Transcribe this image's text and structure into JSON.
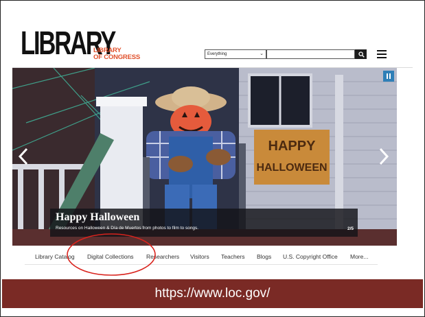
{
  "header": {
    "logo_big": "LIBRARY",
    "logo_small_line1": "LIBRARY",
    "logo_small_line2": "OF CONGRESS",
    "search_scope": "Everything",
    "search_value": ""
  },
  "hero": {
    "title": "Happy Halloween",
    "subtitle": "Resources on Halloween & Día de Muertos from photos to film to songs.",
    "slide_counter": "2/5",
    "sign_text": "HAPPY HALLOWEEN"
  },
  "nav": {
    "items": [
      "Library Catalog",
      "Digital Collections",
      "Researchers",
      "Visitors",
      "Teachers",
      "Blogs",
      "U.S. Copyright Office",
      "More..."
    ]
  },
  "footer": {
    "url": "https://www.loc.gov/"
  },
  "colors": {
    "brand_orange": "#e0502b",
    "band_maroon": "#7a2a25",
    "highlight_red": "#d9231d",
    "pause_blue": "#2f7fb7"
  },
  "icons": [
    "search-icon",
    "menu-icon",
    "pause-icon",
    "chevron-left-icon",
    "chevron-right-icon"
  ]
}
